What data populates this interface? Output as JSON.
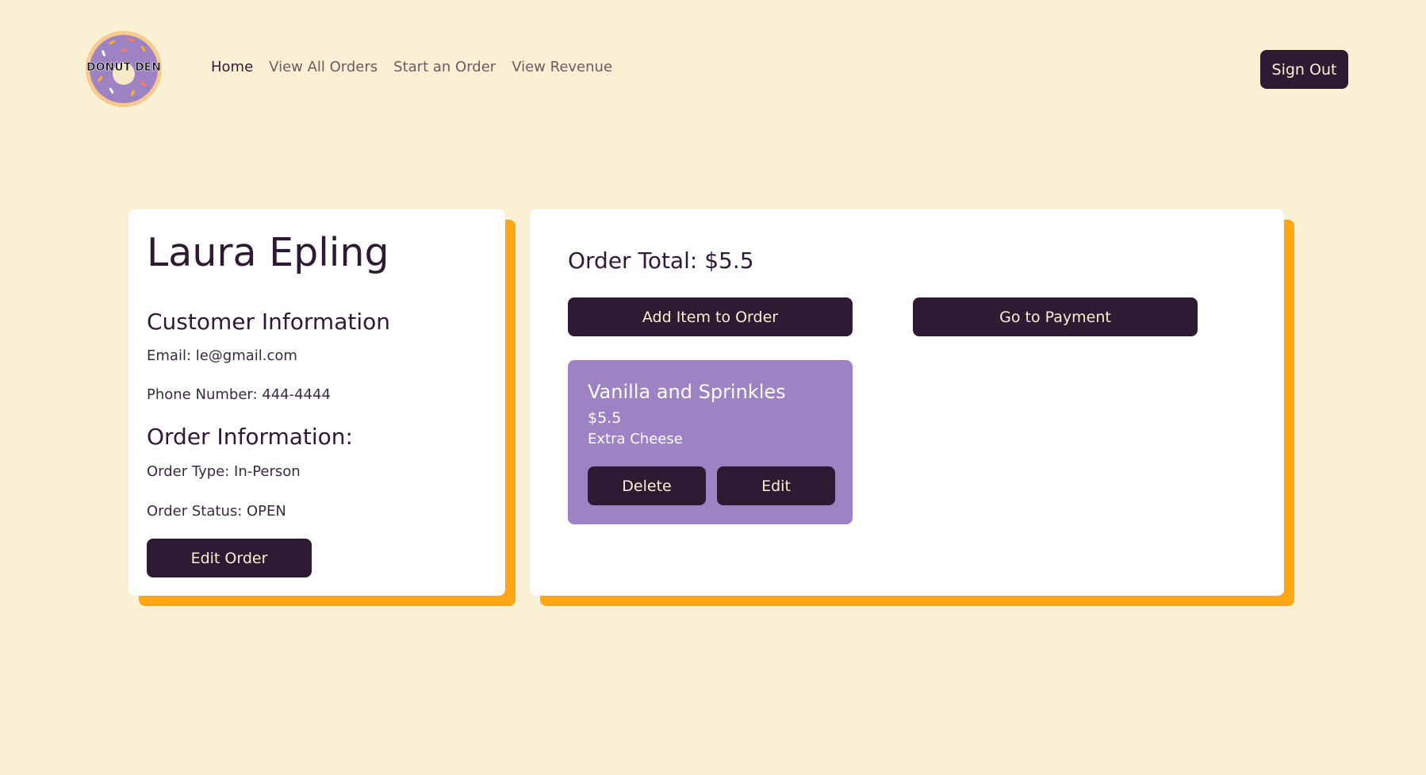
{
  "nav": {
    "logo_text": "DONUT DEN",
    "links": [
      "Home",
      "View All Orders",
      "Start an Order",
      "View Revenue"
    ],
    "active": "Home",
    "signout_label": "Sign Out"
  },
  "customer": {
    "name": "Laura Epling",
    "info_heading": "Customer Information",
    "email": "Email: le@gmail.com",
    "phone": "Phone Number: 444-4444",
    "order_info_heading": "Order Information:",
    "order_type": "Order Type: In-Person",
    "order_status": "Order Status: OPEN",
    "edit_order_label": "Edit Order"
  },
  "order": {
    "total": "Order Total: $5.5",
    "add_item_label": "Add Item to Order",
    "go_payment_label": "Go to Payment",
    "items": [
      {
        "name": "Vanilla and Sprinkles",
        "price": "$5.5",
        "extra": "Extra Cheese",
        "delete_label": "Delete",
        "edit_label": "Edit"
      }
    ]
  },
  "colors": {
    "background": "#faf1d4",
    "dark": "#2e1a33",
    "accent_shadow": "#ffa616",
    "item_card": "#9d83c3"
  }
}
